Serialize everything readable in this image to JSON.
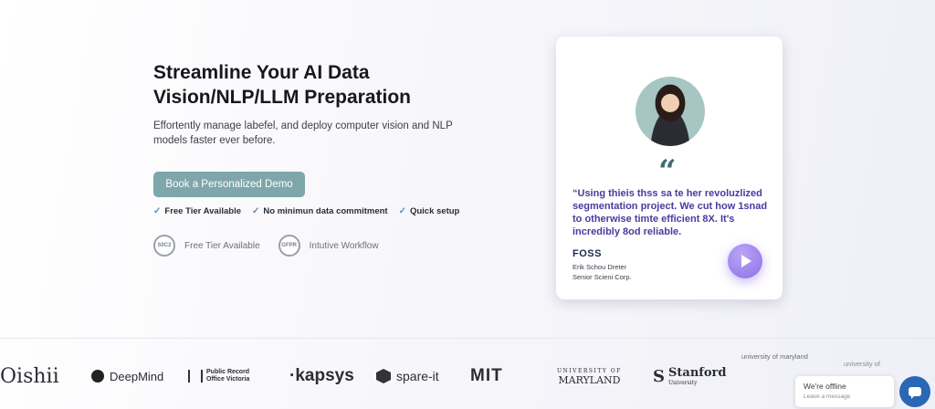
{
  "hero": {
    "headline": "Streamline Your AI Data Vision/NLP/LLM Preparation",
    "subtext": "Effortently manage labefel, and deploy computer vision and NLP models faster ever before.",
    "cta_label": "Book a Personalized Demo",
    "checks": [
      "Free Tier Available",
      "No minimun data commitment",
      "Quick setup"
    ],
    "badges": [
      {
        "icon_text": "S0C2",
        "label": "Free Tier Available"
      },
      {
        "icon_text": "GFPR",
        "label": "Intutive Workflow"
      }
    ]
  },
  "testimonial": {
    "quote_mark": "“",
    "quote": "“Using thieis thss sa te her revoluzlized segmentation project. We cut how 1snad to otherwise timte efficient 8X. It's incredibly 8od reliable.",
    "brand": "FOSS",
    "author_name": "Erik Schou Dreter",
    "author_title": "Senior Scieni Corp."
  },
  "logos": {
    "oishii": "Oishii",
    "deepmind": "DeepMind",
    "prov_line1": "Public Record",
    "prov_line2": "Office Victoria",
    "kapsys": "·kapsys",
    "spare": "spare-it",
    "mit": "MIT",
    "maryland_small": "UNIVERSITY OF",
    "maryland": "MARYLAND",
    "stanford": "Stanford",
    "stanford_sub": "University",
    "broken1": "university of maryland",
    "broken2": "university of"
  },
  "chat": {
    "title": "We're offline",
    "subtitle": "Leave a message"
  },
  "colors": {
    "cta": "#7fa6aa",
    "quote_text": "#4b3aa0",
    "play": "#8d6fe8",
    "chat_button": "#2a67b4"
  }
}
